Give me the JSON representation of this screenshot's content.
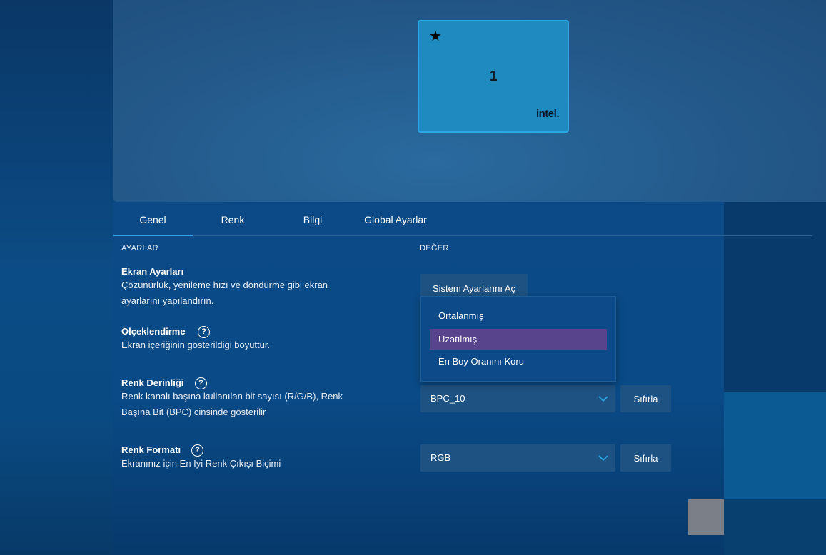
{
  "display": {
    "monitor_number": "1",
    "monitor_brand": "intel.",
    "primary_marker": "★"
  },
  "tabs": [
    {
      "label": "Genel",
      "active": true
    },
    {
      "label": "Renk",
      "active": false
    },
    {
      "label": "Bilgi",
      "active": false
    },
    {
      "label": "Global Ayarlar",
      "active": false
    }
  ],
  "columns": {
    "settings": "AYARLAR",
    "value": "DEĞER"
  },
  "settings": {
    "screen": {
      "title": "Ekran Ayarları",
      "desc_line1": "Çözünürlük, yenileme hızı ve döndürme gibi ekran",
      "desc_line2": "ayarlarını yapılandırın.",
      "button": "Sistem Ayarlarını Aç"
    },
    "scaling": {
      "title": "Ölçeklendirme",
      "desc": "Ekran içeriğinin gösterildiği boyuttur.",
      "help": "?",
      "options": [
        "Ortalanmış",
        "Uzatılmış",
        "En Boy Oranını Koru"
      ],
      "selected": "Uzatılmış"
    },
    "color_depth": {
      "title": "Renk Derinliği",
      "desc_line1": "Renk kanalı başına kullanılan bit sayısı (R/G/B), Renk",
      "desc_line2": "Başına Bit (BPC) cinsinde gösterilir",
      "help": "?",
      "value": "BPC_10",
      "reset": "Sıfırla"
    },
    "color_format": {
      "title": "Renk Formatı",
      "desc": "Ekranınız için En İyi Renk Çıkışı Biçimi",
      "help": "?",
      "value": "RGB",
      "reset": "Sıfırla"
    }
  },
  "colors": {
    "accent": "#2aa8e6",
    "selected_item": "#58438d",
    "control_bg": "#1e5282"
  }
}
